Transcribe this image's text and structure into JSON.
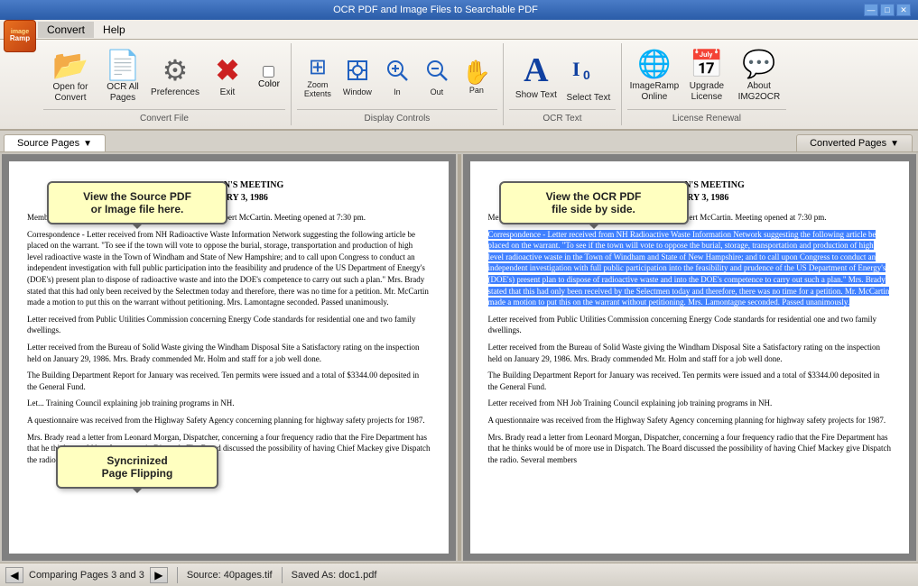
{
  "window": {
    "title": "OCR PDF and Image Files to Searchable PDF",
    "controls": [
      "—",
      "□",
      "✕"
    ]
  },
  "logo": {
    "line1": "image",
    "line2": "Ramp"
  },
  "menu": {
    "items": [
      "Convert",
      "Help"
    ]
  },
  "toolbar": {
    "groups": [
      {
        "label": "Convert File",
        "buttons": [
          {
            "id": "open-for-convert",
            "icon": "📂",
            "label": "Open for Convert",
            "color": "yellow"
          },
          {
            "id": "ocr-all-pages",
            "icon": "📄",
            "label": "OCR All Pages",
            "color": "blue"
          },
          {
            "id": "preferences",
            "icon": "⚙",
            "label": "Preferences",
            "color": "gray"
          },
          {
            "id": "exit",
            "icon": "✕",
            "label": "Exit",
            "color": "red"
          }
        ],
        "extras": [
          {
            "id": "color-checkbox",
            "label": "Color",
            "checked": false
          }
        ]
      },
      {
        "label": "Display Controls",
        "buttons": [
          {
            "id": "zoom-extents",
            "icon": "⊞",
            "label": "Zoom Extents",
            "color": "blue"
          },
          {
            "id": "window",
            "icon": "🔍",
            "label": "Window",
            "color": "blue"
          },
          {
            "id": "zoom-in",
            "icon": "🔍",
            "label": "In",
            "color": "blue"
          },
          {
            "id": "zoom-out",
            "icon": "🔍",
            "label": "Out",
            "color": "blue"
          },
          {
            "id": "pan",
            "icon": "✋",
            "label": "Pan",
            "color": "orange"
          }
        ]
      },
      {
        "label": "OCR Text",
        "buttons": [
          {
            "id": "show-text",
            "icon": "A",
            "label": "Show Text",
            "color": "blue"
          },
          {
            "id": "select-text",
            "icon": "IO",
            "label": "Select Text",
            "color": "blue"
          }
        ]
      },
      {
        "label": "License Renewal",
        "buttons": [
          {
            "id": "imageramp-online",
            "icon": "🌐",
            "label": "ImageRamp Online",
            "color": "blue"
          },
          {
            "id": "upgrade-license",
            "icon": "📅",
            "label": "Upgrade License",
            "color": "blue"
          },
          {
            "id": "about-img2ocr",
            "icon": "💬",
            "label": "About IMG2OCR",
            "color": "blue"
          }
        ]
      }
    ]
  },
  "tabs": {
    "left": {
      "label": "Source Pages",
      "active": true
    },
    "right": {
      "label": "Converted Pages",
      "active": false
    }
  },
  "callouts": {
    "source": {
      "line1": "View the Source PDF",
      "line2": "or Image file here."
    },
    "converted": {
      "line1": "View the OCR PDF",
      "line2": "file side by side."
    },
    "sync": {
      "line1": "Syncrinized",
      "line2": "Page Flipping"
    }
  },
  "document": {
    "title": "SELECTMEN'S MEETING\nFEBRUARY 3, 1986",
    "paragraphs": [
      "Members Present: Virginia Brady, Edna Lamontagne and Robert McCartin.  Meeting opened at 7:30 pm.",
      "Correspondence - Letter received from NH Radioactive Waste Information Network suggesting the following article be placed on the warrant.  \"To see if the town will vote to oppose the burial, storage, transportation and production of high level radioactive waste in the Town of Windham and State of New Hampshire; and to call upon Congress to conduct an independent investigation with full public participation into the feasibility and prudence of the US Department of Energy's (DOE's) present plan to dispose of radioactive waste and into the DOE's competence to carry out such a plan.\"  Mrs. Brady stated that this had only been received by the Selectmen today and therefore, there was no time for a petition.  Mr. McCartin made a motion to put this on the warrant without petitioning.  Mrs. Lamontagne seconded.  Passed unanimously.",
      "Letter received from Public Utilities Commission concerning Energy Code standards for residential one and two family dwellings.",
      "Letter received from the Bureau of Solid Waste giving the Windham Disposal Site a Satisfactory rating on the inspection held on January 29, 1986.  Mrs. Brady commended Mr. Holm and staff for a job well done.",
      "The Building Department Report for January was received.  Ten permits were issued and a total of $3344.00 deposited in the General Fund.",
      "Letter received from NH Job Training Council explaining job training programs in NH.",
      "A questionnaire was received from the Highway Safety Agency concerning planning for highway safety projects for 1987.",
      "Mrs. Brady read a letter from Leonard Morgan, Dispatcher, concerning a four frequency radio that the Fire Department has that he thinks would be of more use in Dispatch.  The Board discussed the possibility of having Chief Mackey give Dispatch the radio.  Several members"
    ]
  },
  "status": {
    "comparing_text": "Comparing Pages 3 and 3",
    "source_text": "Source: 40pages.tif",
    "saved_as": "Saved As: doc1.pdf"
  }
}
